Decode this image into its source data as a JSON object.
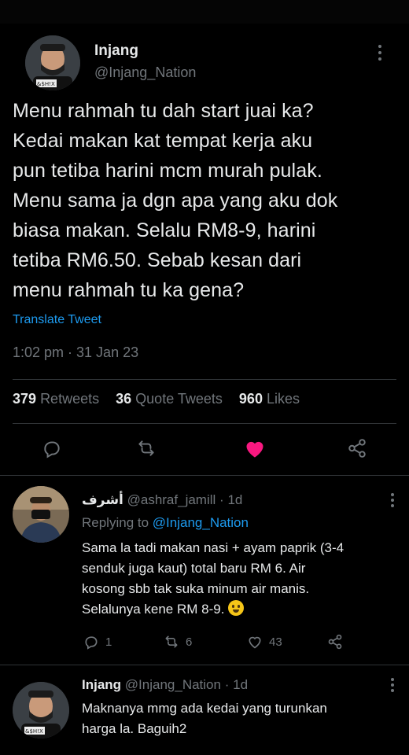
{
  "colors": {
    "background": "#000000",
    "text": "#e7e9ea",
    "muted": "#71767b",
    "link": "#1d9bf0",
    "like": "#f91880",
    "divider": "#2f3336"
  },
  "main_tweet": {
    "display_name": "Injang",
    "handle": "@Injang_Nation",
    "text": "Menu rahmah tu dah start juai ka?\nKedai makan kat tempat kerja aku\npun tetiba harini mcm murah pulak.\nMenu sama ja dgn apa yang aku dok\nbiasa makan. Selalu RM8-9, harini\ntetiba RM6.50. Sebab kesan dari\nmenu rahmah tu ka gena?",
    "translate_label": "Translate Tweet",
    "timestamp": "1:02 pm · 31 Jan 23",
    "stats": {
      "retweets_count": "379",
      "retweets_label": "Retweets",
      "quotes_count": "36",
      "quotes_label": "Quote Tweets",
      "likes_count": "960",
      "likes_label": "Likes"
    },
    "liked": true,
    "icons": [
      "reply-icon",
      "retweet-icon",
      "like-icon",
      "share-icon"
    ]
  },
  "replies": [
    {
      "display_name": "أشرف",
      "handle": "@ashraf_jamill",
      "time": "1d",
      "replying_prefix": "Replying to",
      "replying_to": "@Injang_Nation",
      "text": "Sama la tadi makan nasi + ayam paprik (3-4\nsenduk juga kaut) total baru RM 6. Air\nkosong sbb tak suka minum air manis.\nSelalunya kene RM 8-9.",
      "emoji": "grimacing-face",
      "reply_count": "1",
      "retweet_count": "6",
      "like_count": "43"
    },
    {
      "display_name": "Injang",
      "handle": "@Injang_Nation",
      "time": "1d",
      "text": "Maknanya mmg ada kedai yang turunkan\nharga la. Baguih2"
    }
  ]
}
